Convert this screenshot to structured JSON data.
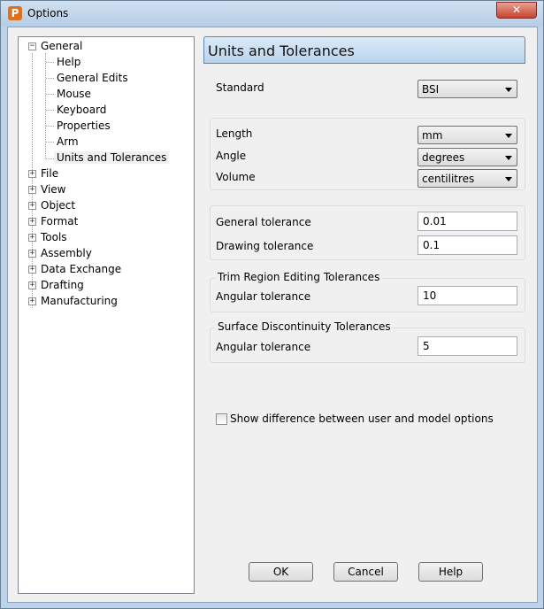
{
  "window": {
    "title": "Options",
    "close_symbol": "✕",
    "app_icon_letter": "P"
  },
  "tree": {
    "general": {
      "label": "General",
      "children": [
        "Help",
        "General Edits",
        "Mouse",
        "Keyboard",
        "Properties",
        "Arm",
        "Units and Tolerances"
      ]
    },
    "roots": [
      "File",
      "View",
      "Object",
      "Format",
      "Tools",
      "Assembly",
      "Data Exchange",
      "Drafting",
      "Manufacturing"
    ]
  },
  "panel": {
    "title": "Units and Tolerances",
    "standard": {
      "label": "Standard",
      "value": "BSI"
    },
    "length": {
      "label": "Length",
      "value": "mm"
    },
    "angle": {
      "label": "Angle",
      "value": "degrees"
    },
    "volume": {
      "label": "Volume",
      "value": "centilitres"
    },
    "general_tolerance": {
      "label": "General tolerance",
      "value": "0.01"
    },
    "drawing_tolerance": {
      "label": "Drawing tolerance",
      "value": "0.1"
    },
    "trim_group": {
      "title": "Trim Region Editing Tolerances",
      "label": "Angular tolerance",
      "value": "10"
    },
    "surface_group": {
      "title": "Surface Discontinuity Tolerances",
      "label": "Angular tolerance",
      "value": "5"
    },
    "show_difference": {
      "label": "Show difference between user and model options",
      "checked": false
    }
  },
  "buttons": {
    "ok": "OK",
    "cancel": "Cancel",
    "help": "Help"
  }
}
